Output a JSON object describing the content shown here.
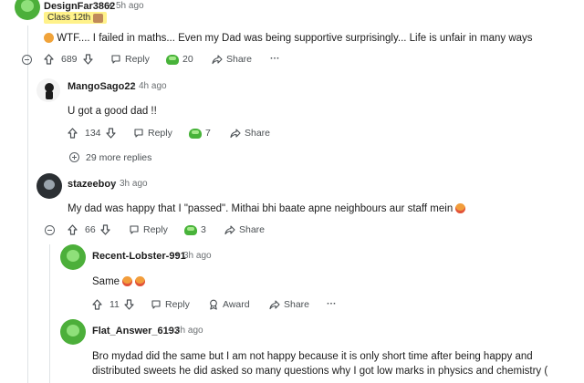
{
  "comments": [
    {
      "username": "DesignFar3862",
      "time": "5h ago",
      "flair": "Class 12th",
      "text": "WTF.... I failed in maths... Even my Dad was being supportive surprisingly... Life is unfair in many ways",
      "votes": "689",
      "reply": "Reply",
      "awards": "20",
      "share": "Share",
      "more": "···"
    },
    {
      "username": "MangoSago22",
      "time": "4h ago",
      "text": "U got a good dad !!",
      "votes": "134",
      "reply": "Reply",
      "awards": "7",
      "share": "Share",
      "more_replies": "29 more replies"
    },
    {
      "username": "stazeeboy",
      "time": "3h ago",
      "text": "My dad was happy that I \"passed\". Mithai bhi baate apne neighbours aur staff mein",
      "votes": "66",
      "reply": "Reply",
      "awards": "3",
      "share": "Share"
    },
    {
      "username": "Recent-Lobster-991",
      "time": "3h ago",
      "text": "Same",
      "votes": "11",
      "reply": "Reply",
      "award": "Award",
      "share": "Share",
      "more": "···"
    },
    {
      "username": "Flat_Answer_6193",
      "time": "3h ago",
      "text": "Bro mydad did the same but I am not happy because it is only short time after being happy and distributed sweets he did asked so many questions why I got low marks in physics and chemistry ("
    }
  ],
  "separator": "•"
}
